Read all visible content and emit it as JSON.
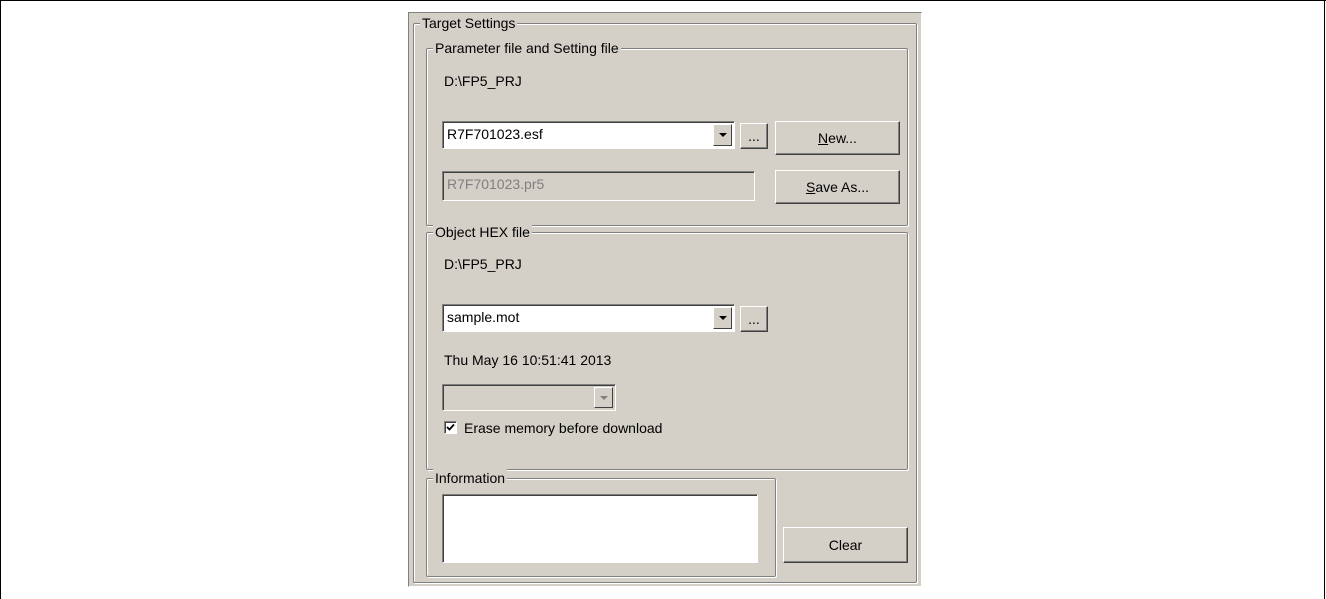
{
  "target_settings": {
    "title": "Target Settings",
    "parameter_group": {
      "title": "Parameter file and Setting file",
      "path": "D:\\FP5_PRJ",
      "parameter_file": "R7F701023.esf",
      "browse_label": "...",
      "new_label": "New...",
      "setting_file": "R7F701023.pr5",
      "save_as_label": "Save As..."
    },
    "hex_group": {
      "title": "Object HEX file",
      "path": "D:\\FP5_PRJ",
      "hex_file": "sample.mot",
      "browse_label": "...",
      "timestamp": "Thu May 16 10:51:41 2013",
      "option_value": "",
      "erase_checked": true,
      "erase_label": "Erase memory before download"
    },
    "info_group": {
      "title": "Information",
      "text": "",
      "clear_label": "Clear"
    }
  }
}
